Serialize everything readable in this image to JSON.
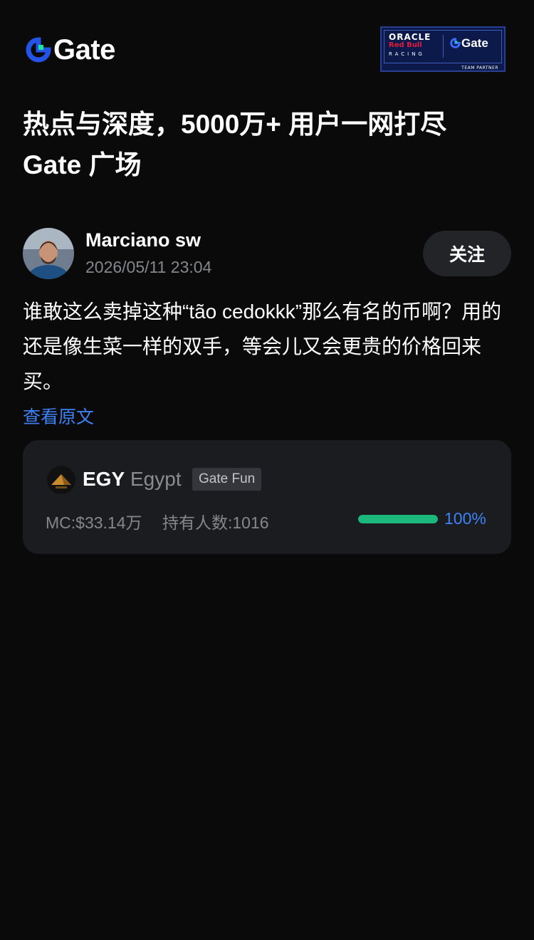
{
  "header": {
    "logo_text": "Gate",
    "logo_icon": "gate-logo-icon",
    "partner_badge": {
      "line1": "ORACLE",
      "line2": "Red Bull",
      "line3": "RACING",
      "brand": "Gate",
      "footer": "TEAM PARTNER"
    }
  },
  "headline": {
    "line1": "热点与深度，5000万+ 用户一网打尽",
    "line2": "Gate 广场"
  },
  "post": {
    "author_name": "Marciano sw",
    "timestamp": "2026/05/11 23:04",
    "follow_label": "关注",
    "body": "谁敢这么卖掉这种“tão cedokkk”那么有名的币啊？用的还是像生菜一样的双手，等会儿又会更贵的价格回来买。",
    "view_original_label": "查看原文"
  },
  "token_card": {
    "symbol": "EGY",
    "name": "Egypt",
    "tag": "Gate Fun",
    "market_cap": "MC:$33.14万",
    "holders": "持有人数:1016",
    "progress_text": "100%",
    "progress_fraction": 1.0
  },
  "colors": {
    "background": "#0a0a0b",
    "card": "#1b1c20",
    "accent_blue": "#3d82f5",
    "progress_green": "#1bb77c",
    "muted_text": "#85878c"
  }
}
